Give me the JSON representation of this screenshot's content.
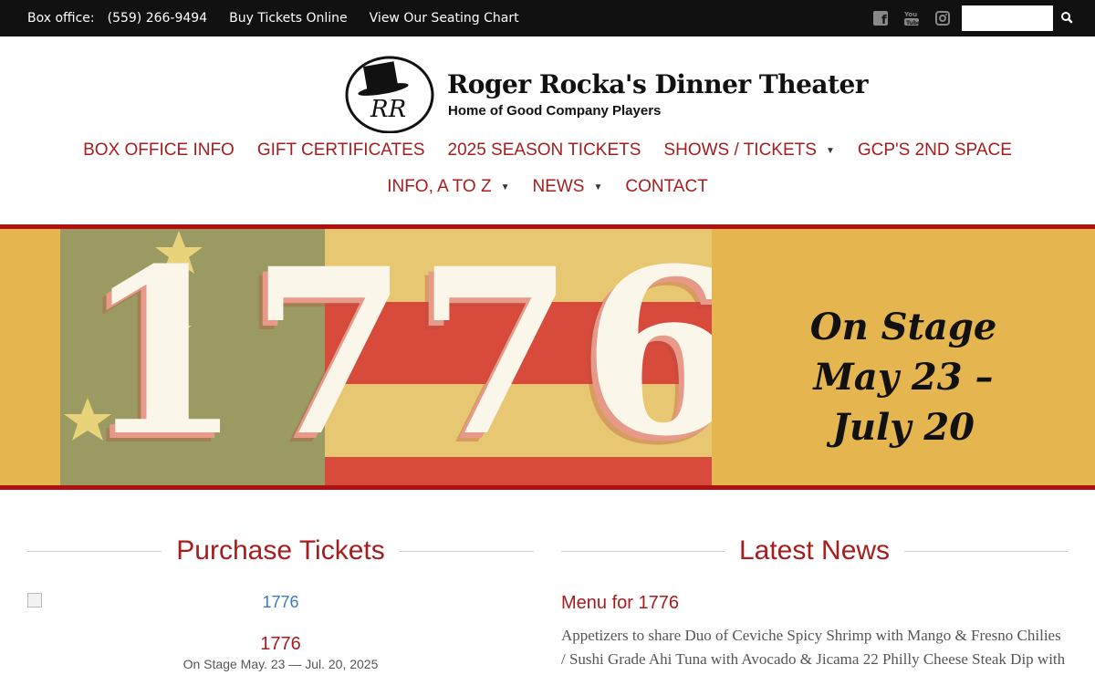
{
  "topbar": {
    "box_office_label": "Box office:",
    "phone": "(559) 266-9494",
    "buy_tickets": "Buy Tickets Online",
    "seating_chart": "View Our Seating Chart",
    "social": [
      {
        "icon": "facebook-icon",
        "glyph": "f"
      },
      {
        "icon": "youtube-icon",
        "glyph": "▶"
      },
      {
        "icon": "instagram-icon",
        "glyph": "◎"
      }
    ],
    "search_placeholder": ""
  },
  "header": {
    "logo_monogram": "RR",
    "title": "Roger Rocka's Dinner Theater",
    "subtitle": "Home of Good Company Players"
  },
  "nav": {
    "row1": [
      {
        "label": "BOX OFFICE INFO",
        "dropdown": false
      },
      {
        "label": "GIFT CERTIFICATES",
        "dropdown": false
      },
      {
        "label": "2025 SEASON TICKETS",
        "dropdown": false
      },
      {
        "label": "SHOWS / TICKETS",
        "dropdown": true
      },
      {
        "label": "GCP'S 2ND SPACE",
        "dropdown": false
      }
    ],
    "row2": [
      {
        "label": "INFO, A TO Z",
        "dropdown": true
      },
      {
        "label": "NEWS",
        "dropdown": true
      },
      {
        "label": "CONTACT",
        "dropdown": false
      }
    ]
  },
  "banner": {
    "year": "1776",
    "stage_line1": "On Stage",
    "stage_line2": "May 23 –",
    "stage_line3": "July 20"
  },
  "purchase": {
    "heading": "Purchase Tickets",
    "image_alt": "1776",
    "show_title": "1776",
    "show_dates": "On Stage May. 23 — Jul. 20, 2025"
  },
  "news": {
    "heading": "Latest News",
    "item_title": "Menu for 1776",
    "item_body": "Appetizers to share  Duo of Ceviche Spicy Shrimp with Mango & Fresno Chilies / Sushi Grade Ahi Tuna with Avocado & Jicama 22 Philly Cheese Steak Dip with"
  },
  "colors": {
    "brand_red": "#a51d1d",
    "banner_gold": "#e5b64f",
    "topbar_black": "#111111"
  }
}
